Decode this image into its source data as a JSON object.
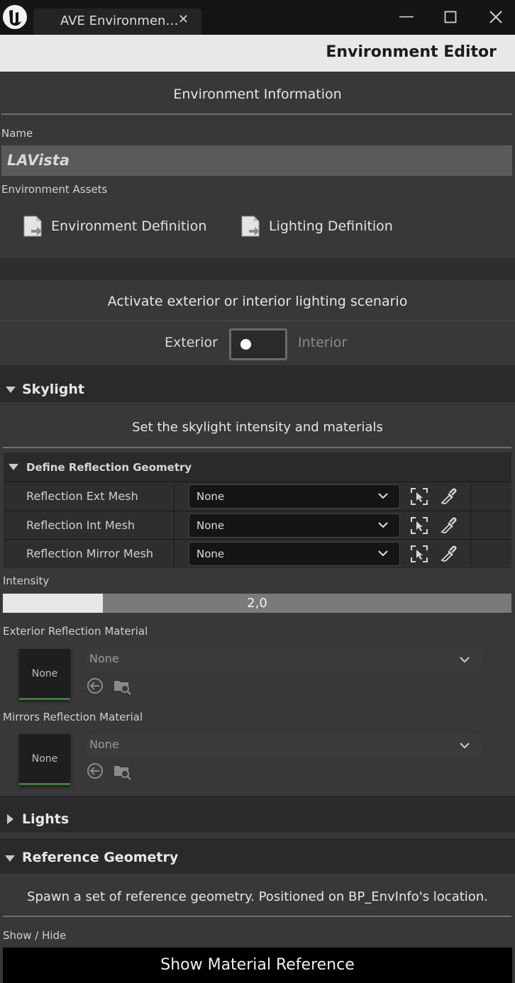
{
  "window": {
    "tab_label": "AVE Environmen…",
    "tab_close": "✕",
    "minimize": "—",
    "maximize": "☐",
    "close": "✕"
  },
  "editor": {
    "title": "Environment Editor"
  },
  "env_info": {
    "heading": "Environment Information",
    "name_label": "Name",
    "name_value": "LAVista",
    "assets_label": "Environment Assets",
    "assets": [
      {
        "label": "Environment Definition",
        "icon": "document-arrow-icon"
      },
      {
        "label": "Lighting Definition",
        "icon": "document-arrow-icon"
      }
    ]
  },
  "scenario": {
    "heading": "Activate exterior or interior lighting scenario",
    "left_label": "Exterior",
    "right_label": "Interior",
    "state": "Exterior"
  },
  "skylight": {
    "header": "Skylight",
    "description": "Set the skylight intensity and materials",
    "group_header": "Define Reflection Geometry",
    "rows": [
      {
        "name": "Reflection Ext Mesh",
        "value": "None"
      },
      {
        "name": "Reflection Int Mesh",
        "value": "None"
      },
      {
        "name": "Reflection Mirror Mesh",
        "value": "None"
      }
    ],
    "intensity_label": "Intensity",
    "intensity_value": "2,0",
    "intensity_fraction": 0.197,
    "materials": [
      {
        "label": "Exterior Reflection Material",
        "thumb": "None",
        "value": "None"
      },
      {
        "label": "Mirrors Reflection Material",
        "thumb": "None",
        "value": "None"
      }
    ]
  },
  "lights": {
    "header": "Lights"
  },
  "reference": {
    "header": "Reference Geometry",
    "description": "Spawn a set of reference geometry. Positioned on BP_EnvInfo's location.",
    "show_hide_label": "Show / Hide",
    "button_label": "Show Material Reference"
  },
  "colors": {
    "titlebar": "#151515",
    "header_band": "#e8e8e8",
    "panel": "#383838",
    "category": "#2a2a2a",
    "thumb_accent": "#3f7a3a"
  }
}
